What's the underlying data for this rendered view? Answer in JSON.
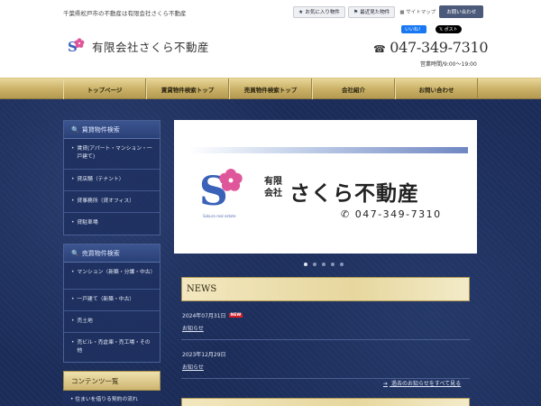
{
  "header": {
    "tagline": "千葉県松戸市の不動産は有限会社さくら不動産",
    "links": {
      "favorites": "お気に入り物件",
      "recent": "最近見た物件",
      "sitemap": "サイトマップ",
      "contact": "お問い合わせ"
    },
    "company_name": "有限会社さくら不動産",
    "social": {
      "facebook": "いいね！",
      "x": "ポスト"
    },
    "phone": "047-349-7310",
    "hours": "営業時間/9:00～19:00"
  },
  "nav": {
    "items": [
      "トップページ",
      "賃貸物件検索トップ",
      "売買物件検索トップ",
      "会社紹介",
      "お問い合わせ"
    ]
  },
  "sidebar": {
    "rental": {
      "title": "賃貸物件検索",
      "items": [
        "賃貸(アパート・マンション・一戸建て)",
        "貸店舗（テナント）",
        "貸事務所（貸オフィス）",
        "貸駐車場"
      ]
    },
    "sale": {
      "title": "売買物件検索",
      "items": [
        "マンション（新築・分譲・中古）",
        "一戸建て（新築・中古）",
        "売土地",
        "売ビル・売倉庫・売工場・その他"
      ]
    },
    "contents": {
      "title": "コンテンツ一覧",
      "first_item": "住まいを借りる契約の流れ"
    }
  },
  "slider": {
    "banner_yugen": "有限会社",
    "banner_name": "さくら不動産",
    "banner_sub": "Sakura real estate",
    "banner_tel": "047-349-7310",
    "dot_count": 5,
    "active_dot": 0
  },
  "news": {
    "title": "NEWS",
    "entries": [
      {
        "date": "2024年07月31日",
        "badge": "NEW",
        "category": "お知らせ"
      },
      {
        "date": "2023年12月29日",
        "badge": "",
        "category": "お知らせ"
      }
    ],
    "view_all": "過去のお知らせをすべて見る"
  },
  "colors": {
    "navy": "#1b2c59",
    "gold": "#c9b066",
    "sakura_pink": "#e0569a",
    "logo_blue": "#3a62b8"
  }
}
